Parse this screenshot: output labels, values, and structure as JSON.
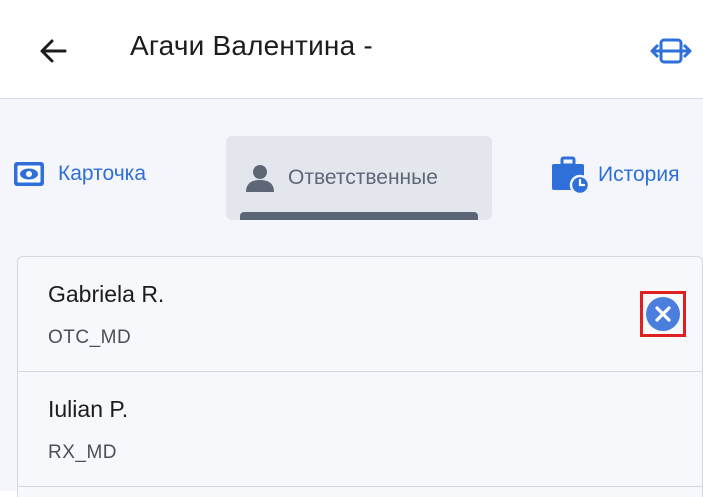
{
  "header": {
    "back_icon": "arrow-left-icon",
    "title": "Агачи Валентина -",
    "expand_icon": "expand-horizontal-icon"
  },
  "tabs": [
    {
      "label": "Карточка",
      "icon": "eye-icon",
      "active": false
    },
    {
      "label": "Ответственные",
      "icon": "person-icon",
      "active": true
    },
    {
      "label": "История",
      "icon": "briefcase-clock-icon",
      "active": false
    }
  ],
  "responsibles": [
    {
      "name": "Gabriela R.",
      "role": "OTC_MD",
      "removable": true
    },
    {
      "name": "Iulian P.",
      "role": "RX_MD",
      "removable": false
    }
  ],
  "colors": {
    "accent": "#2e6fd9",
    "remove_button": "#4a7fde",
    "highlight_border": "#e02020"
  }
}
